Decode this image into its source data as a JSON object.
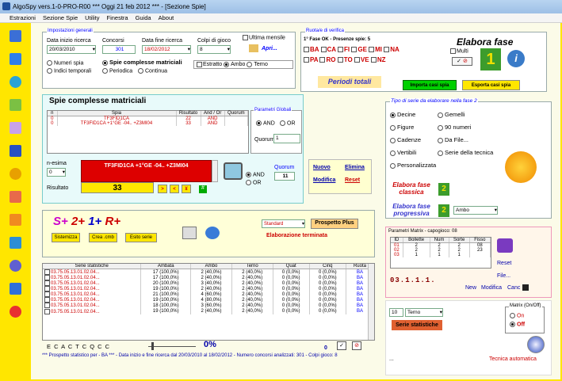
{
  "window": {
    "title": "AlgoSpy vers.1-0-PRO-R00  ***  Oggi 21 feb 2012  ***  - [Sezione Spie]"
  },
  "menu": [
    "Estrazioni",
    "Sezione Spie",
    "Utility",
    "Finestra",
    "Guida",
    "About"
  ],
  "general": {
    "legend": "Impostazioni generali",
    "start_label": "Data inizio ricerca",
    "start_value": "20/03/2010",
    "draws_label": "Concorsi",
    "draws_value": "301",
    "end_label": "Data fine ricerca",
    "end_value": "18/02/2012",
    "shots_label": "Colpi di gioco",
    "shots_value": "8",
    "monthly_label": "Ultima mensile",
    "open_label": "Apri...",
    "num_spia": "Numeri spia",
    "indici": "Indici temporali",
    "spie_compl": "Spie complesse matriciali",
    "periodica": "Periodica",
    "continua": "Continua",
    "estratto": "Estratto",
    "ambo": "Ambo",
    "terno": "Terno"
  },
  "ruote": {
    "legend": "Ruota/e di verifica",
    "fase_text": "1° Fase OK - Presenze spie: 5",
    "row1": [
      "BA",
      "CA",
      "FI",
      "GE",
      "MI",
      "NA"
    ],
    "row2": [
      "PA",
      "RO",
      "TO",
      "VE",
      "NZ"
    ],
    "multi": "Multi",
    "elabora": "Elabora fase",
    "periodi": "Periodi totali",
    "importa": "Importa casi spia",
    "esporta": "Esporta casi spia"
  },
  "spie": {
    "title": "Spie complesse matriciali",
    "headers": [
      "n",
      "Spia",
      "Risultato",
      "And / Or",
      "Quorum"
    ],
    "rows": [
      [
        "0",
        "TF3FID1CA",
        "22",
        "AND",
        ""
      ],
      [
        "0",
        "TF3FID1CA +1°GE -04.. +Z3MI04",
        "33",
        "AND",
        ""
      ]
    ],
    "nesima_label": "n-esima",
    "nesima_value": "0",
    "spia_display": "TF3FID1CA +1°GE -04.. +Z3MI04",
    "risultato_label": "Risultato",
    "risultato_value": "33",
    "and": "AND",
    "or": "OR",
    "quorum_label": "Quorum",
    "quorum_value": "11",
    "nuovo": "Nuovo",
    "elimina": "Elimina",
    "modifica": "Modifica",
    "reset": "Reset"
  },
  "param_globali": {
    "legend": "Parametri Globali",
    "and": "AND",
    "or": "OR",
    "quorum_label": "Quorum",
    "quorum_value": "1"
  },
  "tipo_serie": {
    "legend": "Tipo di serie da elaborare nella fase 2",
    "options": [
      "Decine",
      "Gemelli",
      "Figure",
      "90 numeri",
      "Cadenze",
      "Da File...",
      "Vertibili",
      "Serie della tecnica",
      "Personalizzata"
    ],
    "elabora_classica": "Elabora fase classica",
    "elabora_progressiva": "Elabora fase progressiva",
    "mode_value": "Ambo"
  },
  "splus": {
    "s": "S+",
    "two": "2+",
    "one": "1+",
    "r": "R+",
    "sistemizza": "Sistemizza",
    "crea": "Crea .cmb",
    "esito": "Esito serie",
    "standard": "Standard",
    "prospetto": "Prospetto Plus",
    "status": "Elaborazione terminata"
  },
  "stats": {
    "headers": [
      "Serie statistiche",
      "Ambata",
      "Ambo",
      "Terno",
      "Quat",
      "Cinq",
      "Ruota"
    ],
    "rows": [
      [
        "03.75.05.13.01.02.04...",
        "17 (100,0%)",
        "2 (40,0%)",
        "2 (40,0%)",
        "0 (0,0%)",
        "0 (0,0%)",
        "BA"
      ],
      [
        "03.75.05.13.01.02.04...",
        "17 (100,0%)",
        "2 (40,0%)",
        "2 (40,0%)",
        "0 (0,0%)",
        "0 (0,0%)",
        "BA"
      ],
      [
        "03.75.05.13.01.02.04...",
        "20 (100,0%)",
        "3 (40,0%)",
        "2 (40,0%)",
        "0 (0,0%)",
        "0 (0,0%)",
        "BA"
      ],
      [
        "03.75.05.13.01.02.04...",
        "19 (100,0%)",
        "2 (40,0%)",
        "2 (40,0%)",
        "0 (0,0%)",
        "0 (0,0%)",
        "BA"
      ],
      [
        "03.75.05.13.01.02.04...",
        "21 (100,0%)",
        "4 (60,0%)",
        "2 (40,0%)",
        "0 (0,0%)",
        "0 (0,0%)",
        "BA"
      ],
      [
        "03.75.05.13.01.02.04...",
        "19 (100,0%)",
        "4 (80,0%)",
        "2 (40,0%)",
        "0 (0,0%)",
        "0 (0,0%)",
        "BA"
      ],
      [
        "03.75.05.13.01.02.04...",
        "18 (100,0%)",
        "3 (60,0%)",
        "2 (40,0%)",
        "0 (0,0%)",
        "0 (0,0%)",
        "BA"
      ],
      [
        "03.75.05.13.01.02.04...",
        "19 (100,0%)",
        "2 (40,0%)",
        "2 (40,0%)",
        "0 (0,0%)",
        "0 (0,0%)",
        "BA"
      ]
    ],
    "options": "E C A C T C Q C C",
    "percent": "0%",
    "zero": "0"
  },
  "matrix": {
    "legend": "Parametri Matrix - capogioco: 08",
    "headers": [
      "ID",
      "Bollette",
      "Num",
      "Sorte",
      "Fisso"
    ],
    "rows": [
      [
        "01",
        "2",
        "2",
        "2",
        "08"
      ],
      [
        "02",
        "2",
        "2",
        "2",
        "23"
      ],
      [
        "03",
        "1",
        "1",
        "1",
        ""
      ]
    ],
    "reset": "Reset",
    "file": "File...",
    "code": "03.1.1.1.",
    "new": "New",
    "modifica": "Modifica",
    "canc": "Canc",
    "combo_value": "10",
    "terno": "Terno",
    "serie_stat": "Serie statistiche",
    "matrix_onoff": "Matrix (On/Off)",
    "on": "On",
    "off": "Off",
    "tecnica": "Tecnica automatica",
    "dots": "..."
  },
  "footer": "*** Prospetto statistico per  - BA ***  - Data inizio e fine ricerca dal 20/03/2010 al 18/02/2012 - Numero concorsi analizzati: 301 - Colpi gioco: 8"
}
